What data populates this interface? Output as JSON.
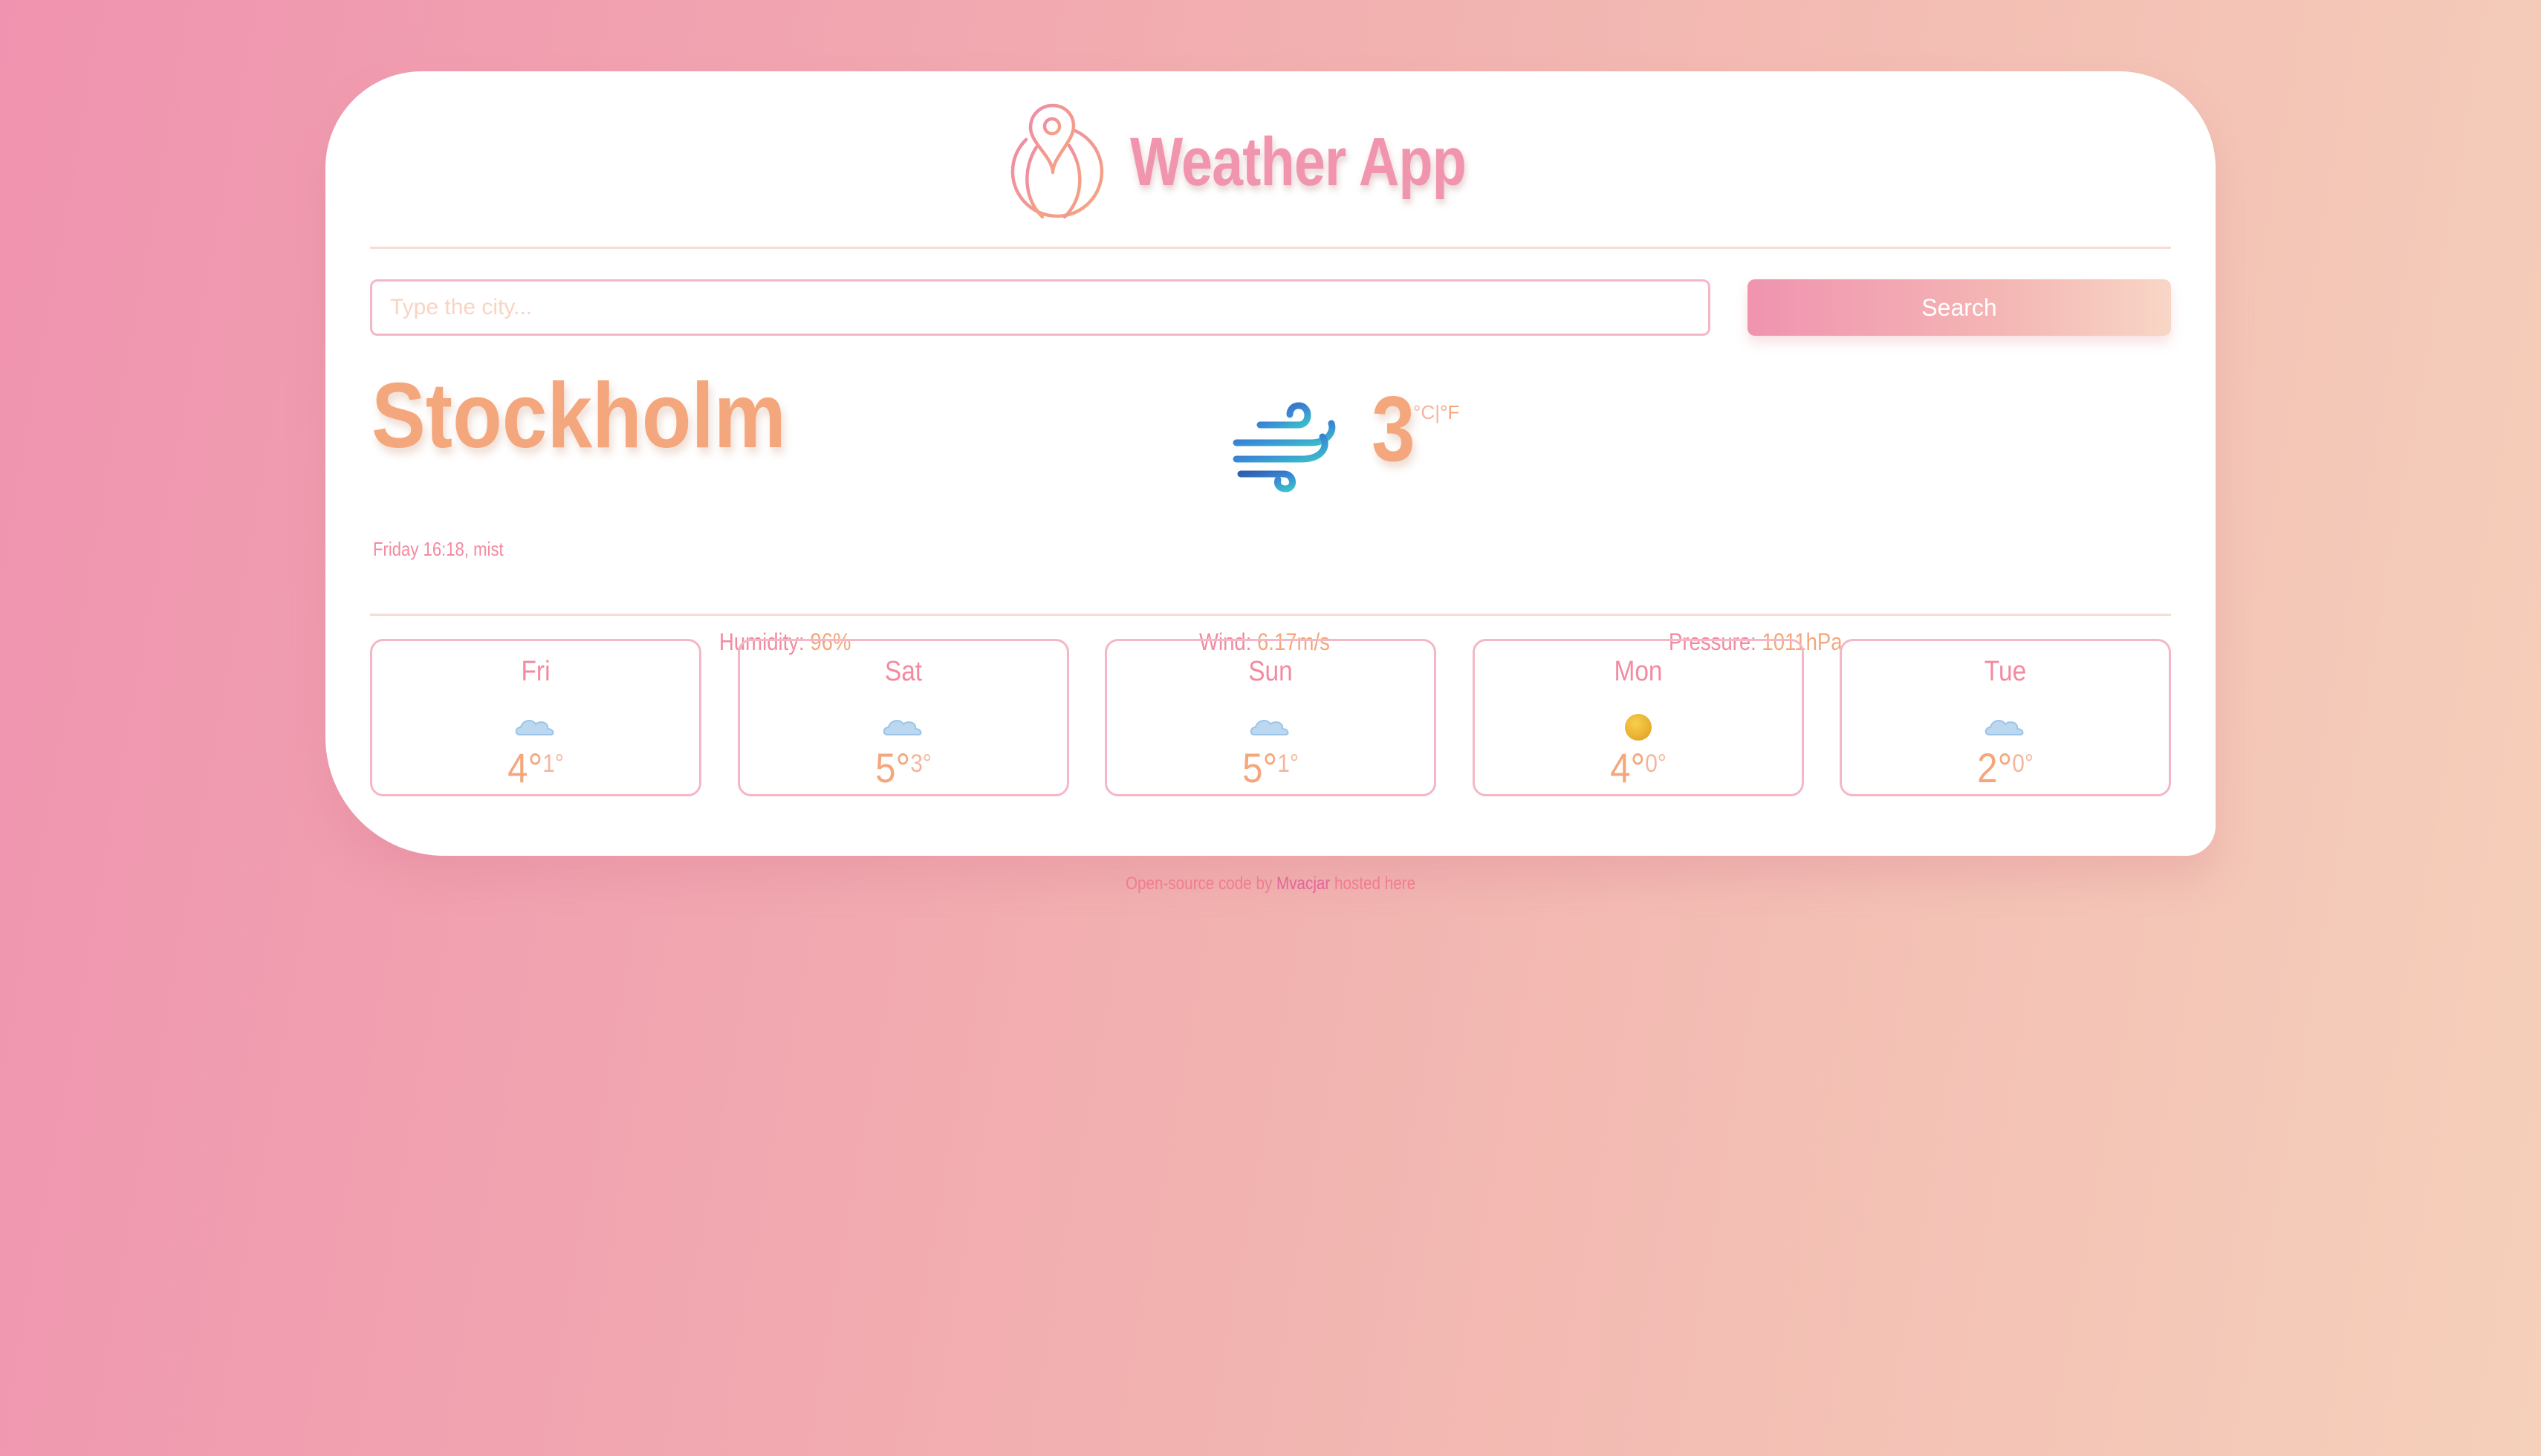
{
  "header": {
    "title": "Weather App",
    "logo_icon": "globe-location-pin-icon"
  },
  "search": {
    "placeholder": "Type the city...",
    "value": "",
    "button_label": "Search"
  },
  "current": {
    "city": "Stockholm",
    "subtitle": "Friday 16:18, mist",
    "icon": "wind-icon",
    "temperature": "3",
    "unit_celsius": "°C",
    "unit_separator": "|",
    "unit_fahrenheit": "°F"
  },
  "stats": {
    "humidity_label": "Humidity:",
    "humidity_value": "96%",
    "wind_label": "Wind:",
    "wind_value": "6.17m/s",
    "pressure_label": "Pressure:",
    "pressure_value": "1011hPa"
  },
  "forecast": [
    {
      "day": "Fri",
      "high": "4°",
      "low": "1°",
      "icon": "cloud-icon"
    },
    {
      "day": "Sat",
      "high": "5°",
      "low": "3°",
      "icon": "cloud-icon"
    },
    {
      "day": "Sun",
      "high": "5°",
      "low": "1°",
      "icon": "cloud-icon"
    },
    {
      "day": "Mon",
      "high": "4°",
      "low": "0°",
      "icon": "sun-icon"
    },
    {
      "day": "Tue",
      "high": "2°",
      "low": "0°",
      "icon": "cloud-icon"
    }
  ],
  "footer": {
    "prefix": "Open-source code",
    "by": "by",
    "author": "Mvacjar",
    "suffix": "hosted here"
  },
  "colors": {
    "accent_pink": "#f38aa0",
    "accent_orange": "#f4a77d",
    "border_pink": "#f4b7c6"
  }
}
